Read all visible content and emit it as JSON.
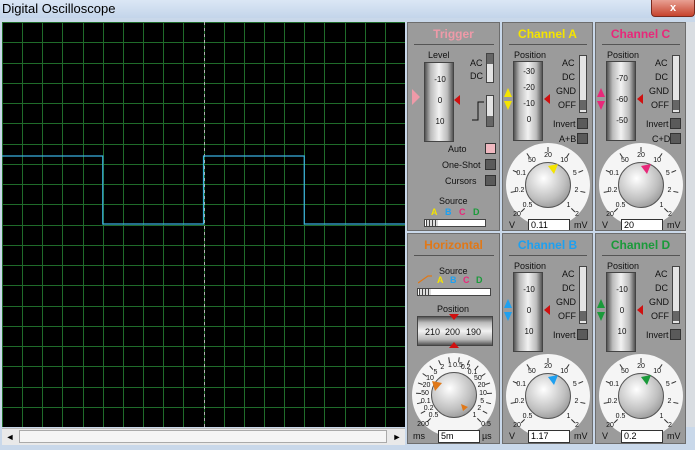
{
  "window": {
    "title": "Digital Oscilloscope",
    "close": "x"
  },
  "screen": {
    "grid_color": "#1f6b2a",
    "center_line_color": "#b0b0b0",
    "trace_color": "#3ab0e0",
    "trace_levels": [
      "high",
      "high",
      "low",
      "low",
      "high",
      "high",
      "low",
      "low"
    ]
  },
  "scrollbar": {
    "left_arrow": "◄",
    "right_arrow": "►"
  },
  "trigger": {
    "title": "Trigger",
    "title_color": "#ee9aa8",
    "level_label": "Level",
    "drum_values": [
      "-10",
      "0",
      "10"
    ],
    "ac": "AC",
    "dc": "DC",
    "auto": "Auto",
    "one_shot": "One-Shot",
    "cursors": "Cursors",
    "source_label": "Source",
    "source_letters": [
      "A",
      "B",
      "C",
      "D"
    ]
  },
  "horizontal": {
    "title": "Horizontal",
    "title_color": "#e07818",
    "source_label": "Source",
    "source_letters": [
      "A",
      "B",
      "C",
      "D"
    ],
    "position_label": "Position",
    "position_values": [
      "210",
      "200",
      "190"
    ],
    "dial_labels": [
      "0.5",
      "0.2",
      "0.1",
      "50",
      "20",
      "10",
      "5",
      "2",
      "1",
      "0.5",
      "0.2",
      "0.1",
      "50",
      "20",
      "10",
      "5",
      "2",
      "1",
      "0.5",
      "200"
    ],
    "bottom_left": "200",
    "bottom_right": "0.5",
    "unit_left": "ms",
    "value": "5m",
    "unit_right": "µs",
    "pointer_color": "#e07818"
  },
  "channels": [
    {
      "id": "a",
      "title": "Channel A",
      "color": "#f4e400",
      "drum": [
        "-30",
        "-20",
        "-10",
        "0"
      ],
      "value": "0.11",
      "extra": "A+B",
      "invert": "Invert"
    },
    {
      "id": "b",
      "title": "Channel B",
      "color": "#1ea0f0",
      "drum": [
        "-10",
        "0",
        "10"
      ],
      "value": "1.17",
      "extra": "",
      "invert": "Invert"
    },
    {
      "id": "c",
      "title": "Channel C",
      "color": "#e8287a",
      "drum": [
        "-70",
        "-60",
        "-50"
      ],
      "value": "20",
      "extra": "C+D",
      "invert": "Invert"
    },
    {
      "id": "d",
      "title": "Channel D",
      "color": "#1a9a3a",
      "drum": [
        "-10",
        "0",
        "10"
      ],
      "value": "0.2",
      "extra": "",
      "invert": "Invert"
    }
  ],
  "coupling": [
    "AC",
    "DC",
    "GND",
    "OFF"
  ],
  "channel_position_label": "Position",
  "volts_dial_labels": [
    "0.5",
    "0.2",
    "0.1",
    "50",
    "20",
    "10",
    "5",
    "2",
    "1"
  ],
  "volts_bottom_left": "20",
  "volts_bottom_right": "2",
  "unit_v": "V",
  "unit_mv": "mV"
}
